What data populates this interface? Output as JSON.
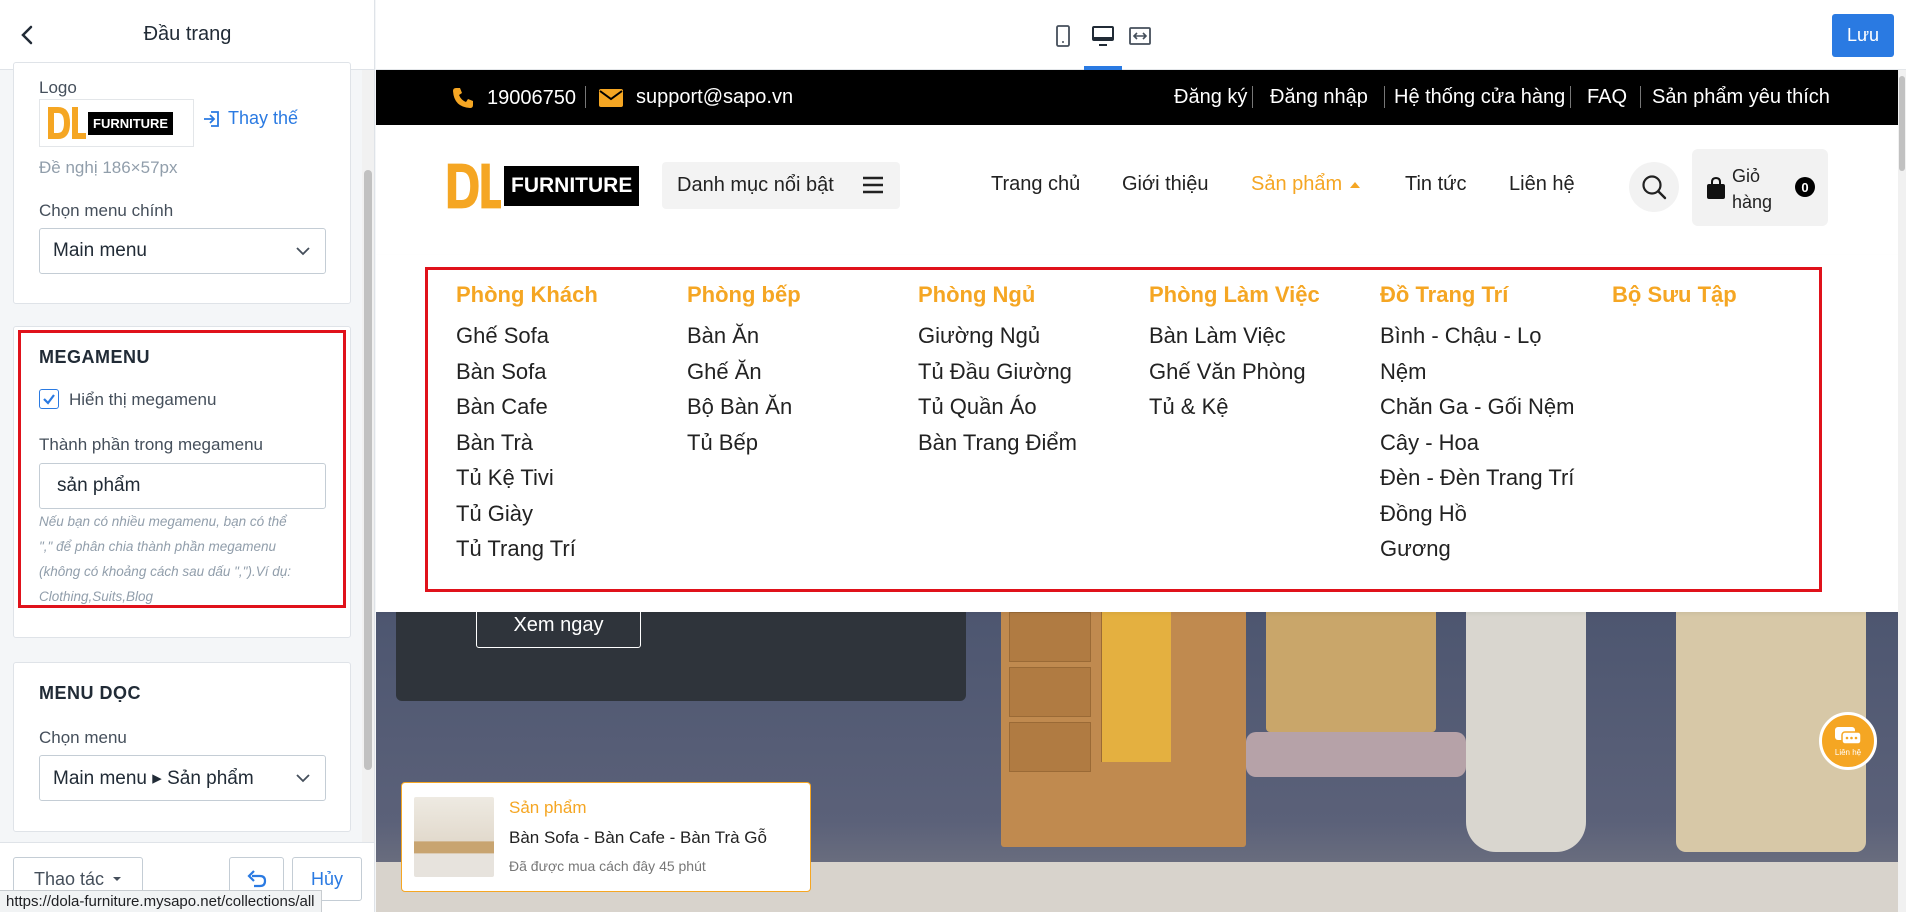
{
  "panel": {
    "title": "Đầu trang",
    "logo": {
      "label": "Logo",
      "mark": "DL",
      "word": "FURNITURE",
      "replace_label": "Thay thế",
      "size_hint": "Đề nghị 186×57px"
    },
    "main_menu": {
      "label": "Chọn menu chính",
      "value": "Main menu"
    },
    "megamenu": {
      "title": "MEGAMENU",
      "show_label": "Hiển thị megamenu",
      "show_checked": true,
      "components_label": "Thành phần trong megamenu",
      "components_value": "sản phẩm",
      "help_lines": [
        "Nếu bạn có nhiều megamenu, bạn có thể",
        "\",\" để phân chia thành phần megamenu",
        "(không có khoảng cách sau dấu \",\").Ví dụ:",
        "Clothing,Suits,Blog"
      ]
    },
    "vertical_menu": {
      "title": "MENU DỌC",
      "label": "Chọn menu",
      "value": "Main menu ▸ Sản phẩm"
    },
    "footer": {
      "actions_label": "Thao tác",
      "cancel_label": "Hủy"
    },
    "status_url": "https://dola-furniture.mysapo.net/collections/all"
  },
  "toolbar": {
    "save_label": "Lưu"
  },
  "site": {
    "phone": "19006750",
    "email": "support@sapo.vn",
    "top_links": [
      "Đăng ký",
      "Đăng nhập",
      "Hệ thống cửa hàng",
      "FAQ",
      "Sản phẩm yêu thích"
    ],
    "logo_mark": "DL",
    "logo_word": "FURNITURE",
    "category_button": "Danh mục nổi bật",
    "nav": [
      "Trang chủ",
      "Giới thiệu",
      "Sản phẩm",
      "Tin tức",
      "Liên hệ"
    ],
    "nav_active_index": 2,
    "cart_label": "Giỏ hàng",
    "cart_count": "0",
    "mega_columns": [
      {
        "title": "Phòng Khách",
        "items": [
          "Ghế Sofa",
          "Bàn Sofa",
          "Bàn Cafe",
          "Bàn Trà",
          "Tủ Kệ Tivi",
          "Tủ Giày",
          "Tủ Trang Trí"
        ]
      },
      {
        "title": "Phòng bếp",
        "items": [
          "Bàn Ăn",
          "Ghế Ăn",
          "Bộ Bàn Ăn",
          "Tủ Bếp"
        ]
      },
      {
        "title": "Phòng Ngủ",
        "items": [
          "Giường Ngủ",
          "Tủ Đầu Giường",
          "Tủ Quần Áo",
          "Bàn Trang Điểm"
        ]
      },
      {
        "title": "Phòng Làm Việc",
        "items": [
          "Bàn Làm Việc",
          "Ghế Văn Phòng",
          "Tủ & Kệ"
        ]
      },
      {
        "title": "Đồ Trang Trí",
        "items": [
          "Bình - Chậu - Lọ",
          "Nệm",
          "Chăn Ga - Gối Nệm",
          "Cây - Hoa",
          "Đèn - Đèn Trang Trí",
          "Đồng Hồ",
          "Gương"
        ]
      },
      {
        "title": "Bộ Sưu Tập",
        "items": []
      }
    ],
    "hero_button": "Xem ngay",
    "chat_label": "Liên hệ",
    "purchase": {
      "title": "Sản phẩm",
      "name": "Bàn Sofa - Bàn Cafe - Bàn Trà Gỗ",
      "time": "Đã được mua cách đây 45 phút"
    }
  },
  "colors": {
    "accent_orange": "#f5a623",
    "primary_blue": "#2a7ae2",
    "highlight_red": "#e0121b"
  }
}
